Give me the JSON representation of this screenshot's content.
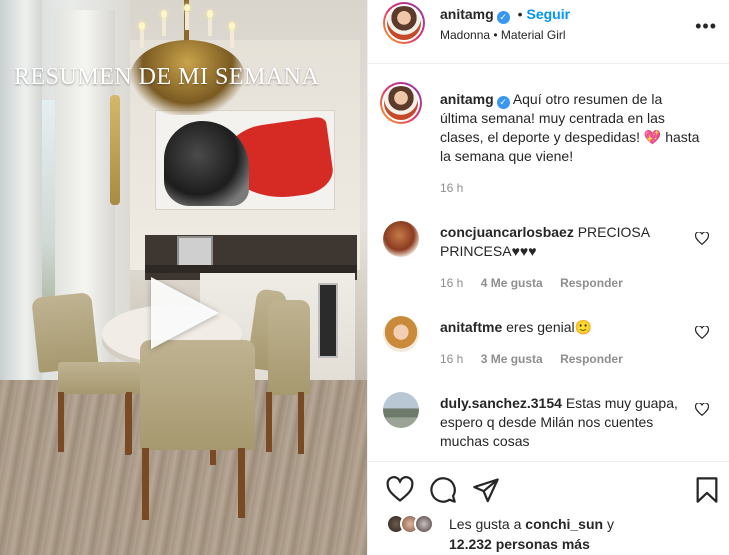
{
  "post": {
    "overlay_title": "RESUMEN DE MI SEMANA"
  },
  "header": {
    "username": "anitamg",
    "dot": "•",
    "follow_label": "Seguir",
    "location": "Madonna • Material Girl",
    "more_label": "•••"
  },
  "caption": {
    "username": "anitamg",
    "text": "Aquí otro resumen de la última semana! muy centrada en las clases, el deporte y despedidas! 💖 hasta la semana que viene!",
    "time": "16 h"
  },
  "comments": [
    {
      "username": "concjuancarlosbaez",
      "text": "PRECIOSA PRINCESA♥♥♥",
      "time": "16 h",
      "likes": "4 Me gusta",
      "reply": "Responder"
    },
    {
      "username": "anitaftme",
      "text": "eres genial🙂",
      "time": "16 h",
      "likes": "3 Me gusta",
      "reply": "Responder"
    },
    {
      "username": "duly.sanchez.3154",
      "text": "Estas muy guapa, espero q desde Milán nos cuentes muchas cosas",
      "time": "",
      "likes": "",
      "reply": ""
    }
  ],
  "likes": {
    "prefix": "Les gusta a",
    "user": "conchi_sun",
    "suffix": "y",
    "count": "12.232 personas más"
  },
  "icons": {
    "like": "heart-icon",
    "comment": "comment-icon",
    "share": "paper-plane-icon",
    "save": "bookmark-icon"
  }
}
